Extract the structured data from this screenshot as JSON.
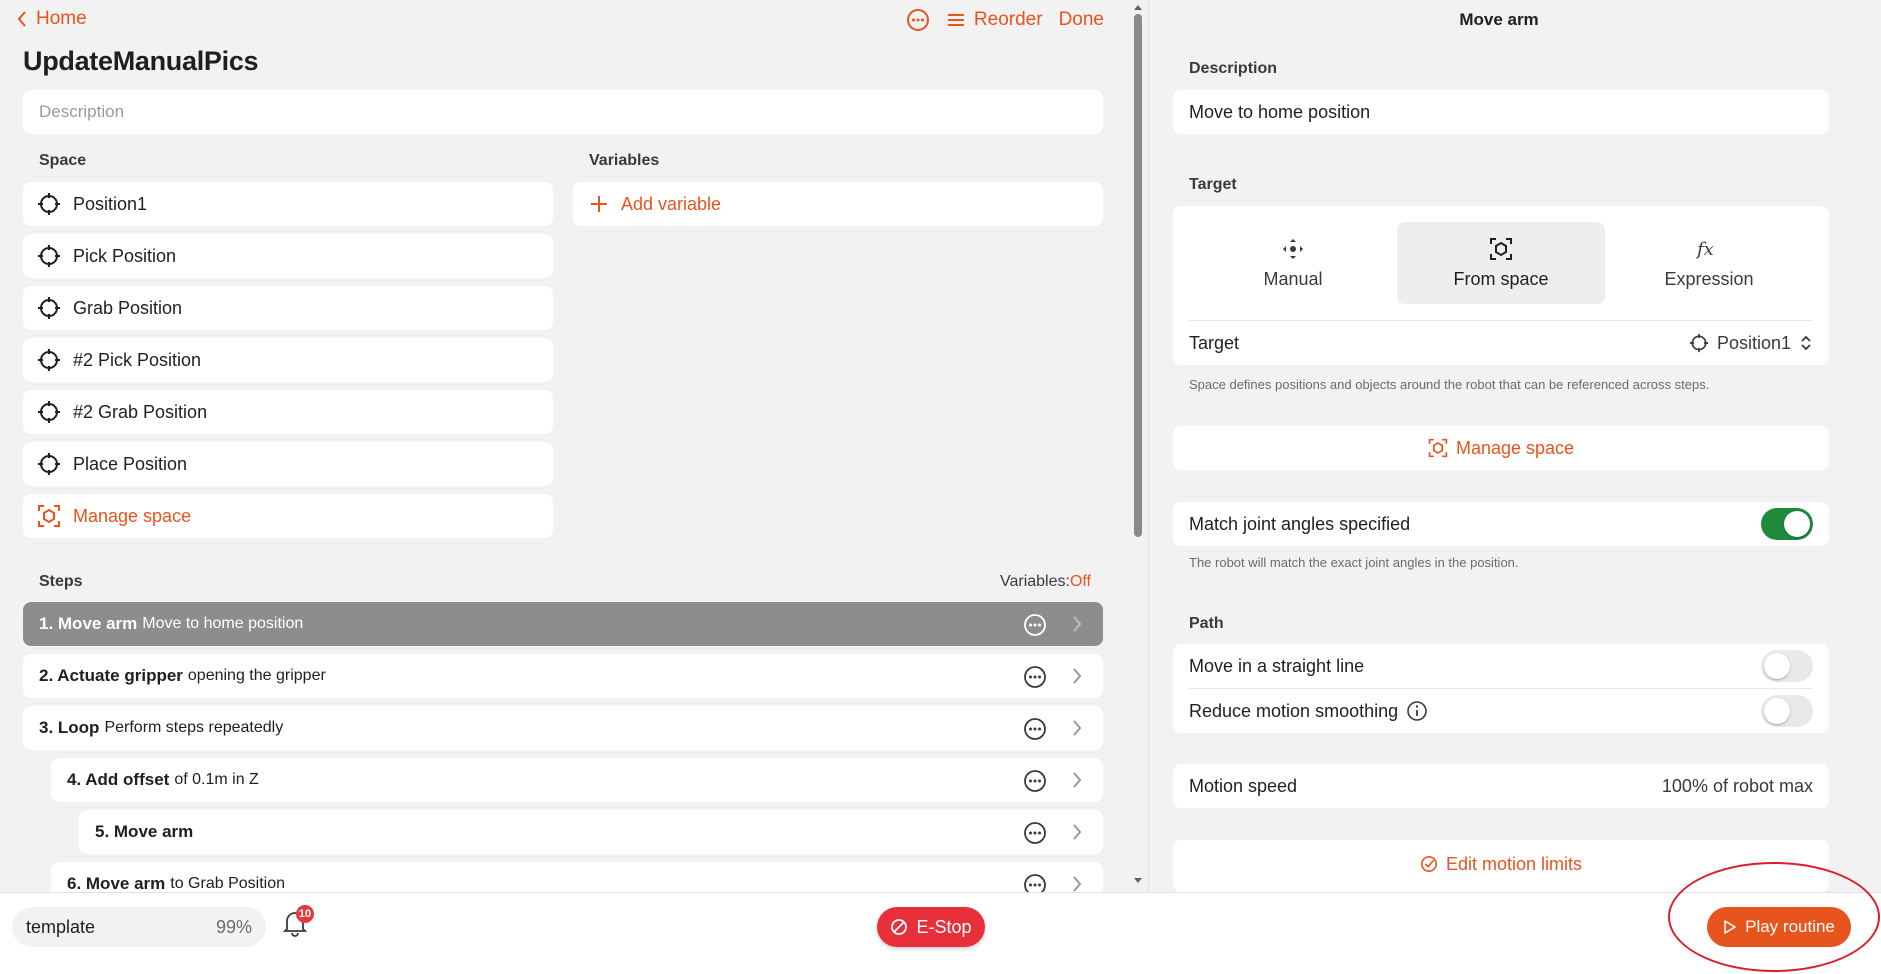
{
  "header": {
    "back_label": "Home",
    "reorder_label": "Reorder",
    "done_label": "Done"
  },
  "routine": {
    "title": "UpdateManualPics",
    "description_placeholder": "Description"
  },
  "space": {
    "label": "Space",
    "items": [
      "Position1",
      "Pick Position",
      "Grab Position",
      "#2 Pick Position",
      "#2 Grab Position",
      "Place Position"
    ],
    "manage_label": "Manage space"
  },
  "variables": {
    "label": "Variables",
    "add_label": "Add variable"
  },
  "steps": {
    "label": "Steps",
    "variables_label": "Variables:",
    "variables_state": "Off",
    "items": [
      {
        "num_title": "1. Move arm",
        "detail": "Move to home position"
      },
      {
        "num_title": "2. Actuate gripper",
        "detail": "opening the gripper"
      },
      {
        "num_title": "3. Loop",
        "detail": "Perform steps repeatedly"
      },
      {
        "num_title": "4. Add offset",
        "detail": "of 0.1m in Z"
      },
      {
        "num_title": "5. Move arm",
        "detail": ""
      },
      {
        "num_title": "6. Move arm",
        "detail": "to Grab Position"
      }
    ]
  },
  "detail": {
    "title": "Move arm",
    "description_label": "Description",
    "description_value": "Move to home position",
    "target_label": "Target",
    "tabs": [
      "Manual",
      "From space",
      "Expression"
    ],
    "target_row_label": "Target",
    "target_value": "Position1",
    "space_note": "Space defines positions and objects around the robot that can be referenced across steps.",
    "manage_space_label": "Manage space",
    "match_joint_label": "Match joint angles specified",
    "match_joint_on": true,
    "match_joint_note": "The robot will match the exact joint angles in the position.",
    "path_label": "Path",
    "straight_line_label": "Move in a straight line",
    "reduce_smoothing_label": "Reduce motion smoothing",
    "motion_speed_label": "Motion speed",
    "motion_speed_value": "100% of robot max",
    "edit_limits_label": "Edit motion limits"
  },
  "footer": {
    "template_name": "template",
    "template_pct": "99%",
    "notification_count": "10",
    "estop_label": "E-Stop",
    "play_label": "Play routine"
  },
  "colors": {
    "accent": "#e8541e",
    "estop": "#e8303a",
    "toggle_on": "#1f8a3c",
    "active_step": "#8d8d8f"
  }
}
